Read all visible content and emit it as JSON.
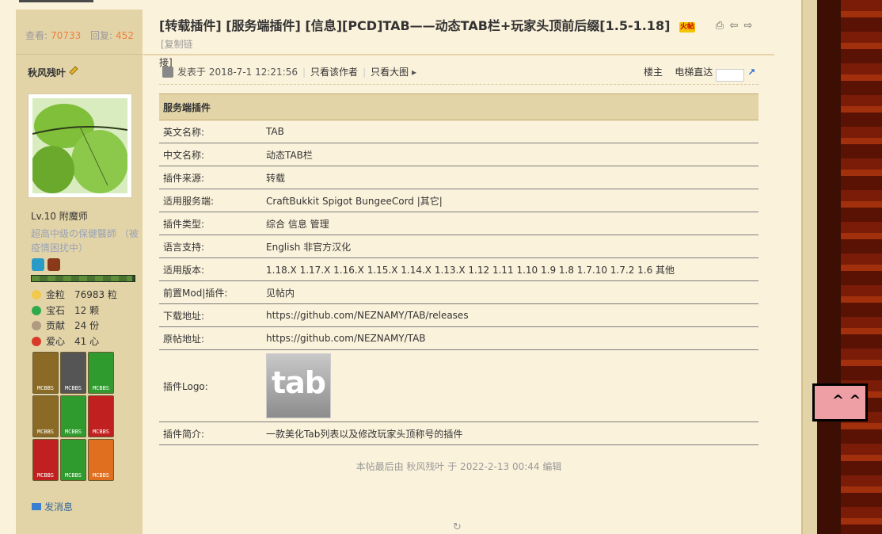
{
  "stats": {
    "views_label": "查看:",
    "views": "70733",
    "replies_label": "回复:",
    "replies": "452"
  },
  "thread": {
    "title": "[转载插件] [服务端插件] [信息][PCD]TAB——动态TAB栏+玩家头顶前后缀[1.5-1.18]",
    "title_tail": "接]",
    "hot_label": "火帖",
    "copy_label": "[复制链"
  },
  "user": {
    "name": "秋风残叶",
    "level": "Lv.10 附魔师",
    "custom_title": "超高中级の保健醫師 （被疫情困扰中）",
    "progress": 0.98,
    "currencies": [
      {
        "label": "金粒",
        "value": "76983 粒",
        "color": "#f2c94c"
      },
      {
        "label": "宝石",
        "value": "12 颗",
        "color": "#2eaa4a"
      },
      {
        "label": "贡献",
        "value": "24 份",
        "color": "#b09a80"
      },
      {
        "label": "爱心",
        "value": "41 心",
        "color": "#d83a2a"
      }
    ],
    "send_message": "发消息"
  },
  "post": {
    "posted_label": "发表于 2018-7-1 12:21:56",
    "only_author": "只看该作者",
    "only_big": "只看大图",
    "floor": "楼主",
    "elevator": "电梯直达"
  },
  "table": {
    "header": "服务端插件",
    "rows": [
      {
        "k": "英文名称:",
        "v": "TAB"
      },
      {
        "k": "中文名称:",
        "v": "动态TAB栏"
      },
      {
        "k": "插件来源:",
        "v": "转载"
      },
      {
        "k": "适用服务端:",
        "v": "CraftBukkit Spigot BungeeCord |其它|"
      },
      {
        "k": "插件类型:",
        "v": "综合 信息 管理"
      },
      {
        "k": "语言支持:",
        "v": "English 非官方汉化"
      },
      {
        "k": "适用版本:",
        "v": "1.18.X 1.17.X 1.16.X 1.15.X 1.14.X 1.13.X 1.12 1.11 1.10 1.9 1.8 1.7.10 1.7.2 1.6 其他"
      },
      {
        "k": "前置Mod|插件:",
        "v": "见帖内"
      },
      {
        "k": "下载地址:",
        "v": "https://github.com/NEZNAMY/TAB/releases"
      },
      {
        "k": "原帖地址:",
        "v": "https://github.com/NEZNAMY/TAB"
      },
      {
        "k": "插件Logo:",
        "v": "tab"
      },
      {
        "k": "插件简介:",
        "v": "一款美化Tab列表以及修改玩家头顶称号的插件"
      }
    ]
  },
  "edited": "本帖最后由 秋风残叶 于 2022-2-13 00:44 编辑",
  "badge_label": "MCBBS"
}
